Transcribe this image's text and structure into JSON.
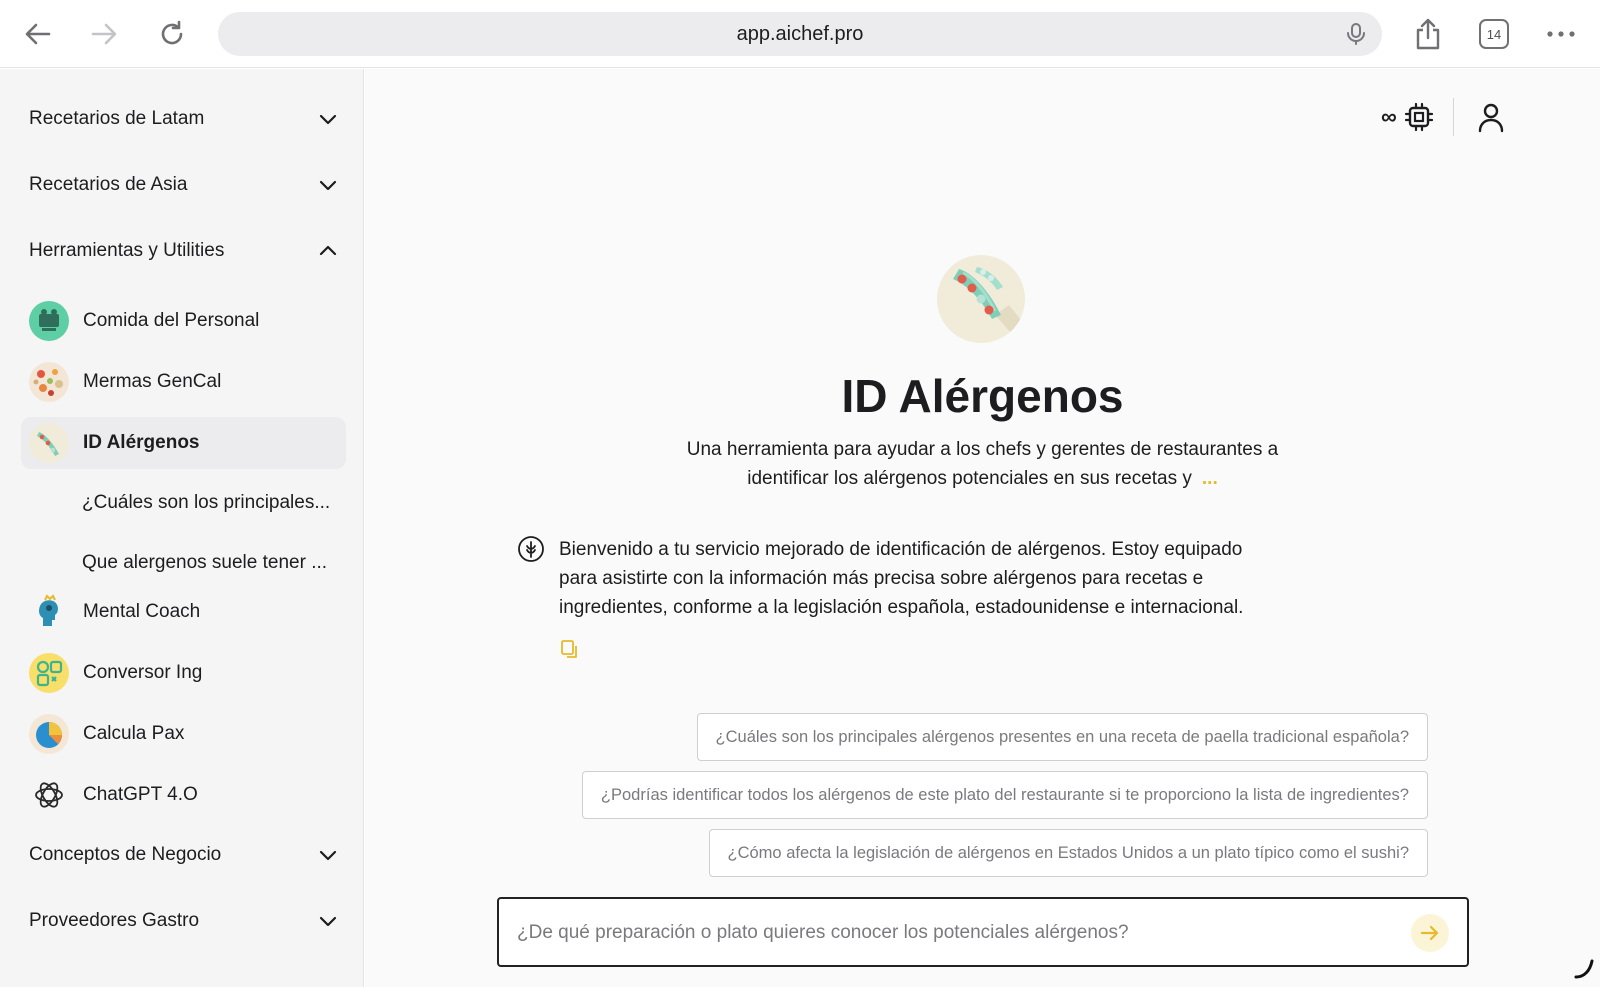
{
  "browser": {
    "url": "app.aichef.pro",
    "tab_count": "14"
  },
  "sidebar": {
    "sections": [
      {
        "label": "Recetarios de Latam",
        "expanded": false
      },
      {
        "label": "Recetarios de Asia",
        "expanded": false
      },
      {
        "label": "Herramientas y Utilities",
        "expanded": true
      },
      {
        "label": "Conceptos de Negocio",
        "expanded": false
      },
      {
        "label": "Proveedores Gastro",
        "expanded": false
      }
    ],
    "tools": [
      {
        "label": "Comida del Personal",
        "icon": "staff-meal-icon"
      },
      {
        "label": "Mermas GenCal",
        "icon": "food-waste-icon"
      },
      {
        "label": "ID Alérgenos",
        "icon": "beans-icon",
        "active": true
      },
      {
        "label": "Mental Coach",
        "icon": "head-icon"
      },
      {
        "label": "Conversor Ing",
        "icon": "converter-icon"
      },
      {
        "label": "Calcula Pax",
        "icon": "pie-chart-icon"
      },
      {
        "label": "ChatGPT 4.O",
        "icon": "openai-icon"
      }
    ],
    "conversations": [
      "¿Cuáles son los principales...",
      "Que alergenos suele tener ..."
    ]
  },
  "main": {
    "title": "ID Alérgenos",
    "description_line1": "Una herramienta para ayudar a los chefs y gerentes de restaurantes a",
    "description_line2": "identificar los alérgenos potenciales en sus recetas y",
    "more_label": "...",
    "bot_message": "Bienvenido a tu servicio mejorado de identificación de alérgenos. Estoy equipado para asistirte con la información más precisa sobre alérgenos para recetas e ingredientes, conforme a la legislación española, estadounidense e internacional.",
    "suggestions": [
      "¿Cuáles son los principales alérgenos presentes en una receta de paella tradicional española?",
      "¿Podrías identificar todos los alérgenos de este plato del restaurante si te proporciono la lista de ingredientes?",
      "¿Cómo afecta la legislación de alérgenos en Estados Unidos a un plato típico como el sushi?"
    ],
    "input_placeholder": "¿De qué preparación o plato quieres conocer los potenciales alérgenos?",
    "accent_color": "#e7b92b"
  }
}
